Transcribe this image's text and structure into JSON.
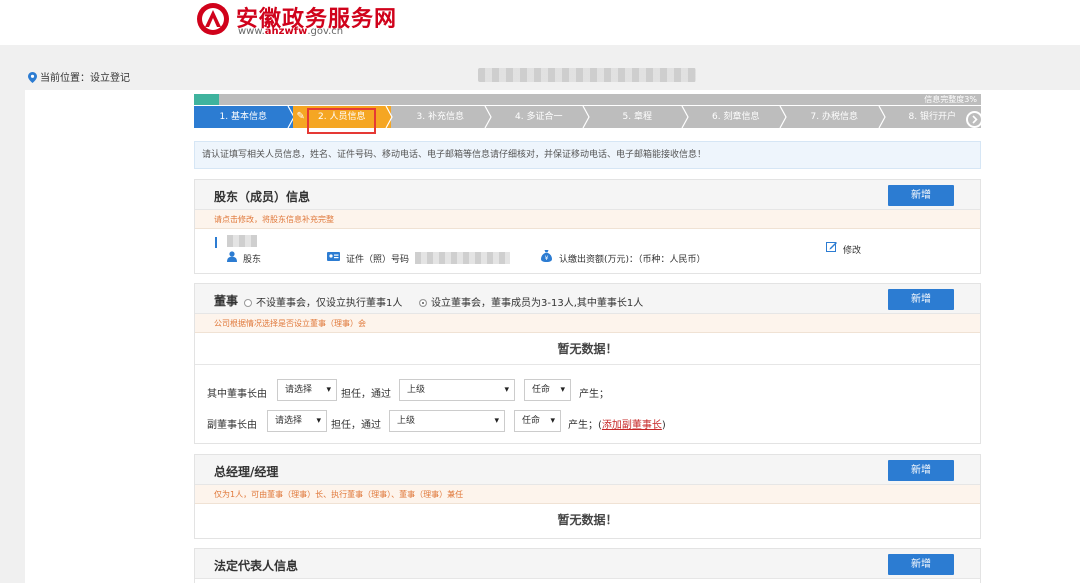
{
  "header": {
    "title": "安徽政务服务网",
    "url_prefix": "www.",
    "url_brand": "ahzwfw",
    "url_suffix": ".gov.cn"
  },
  "location": {
    "label": "当前位置：设立登记"
  },
  "progress": {
    "text": "信息完整度3%",
    "fraction": 0.03
  },
  "steps": [
    {
      "label": "1. 基本信息",
      "state": "done"
    },
    {
      "label": "2. 人员信息",
      "state": "current"
    },
    {
      "label": "3. 补充信息",
      "state": "todo"
    },
    {
      "label": "4. 多证合一",
      "state": "todo"
    },
    {
      "label": "5. 章程",
      "state": "todo"
    },
    {
      "label": "6. 刻章信息",
      "state": "todo"
    },
    {
      "label": "7. 办税信息",
      "state": "todo"
    },
    {
      "label": "8. 银行开户",
      "state": "todo"
    }
  ],
  "notice": "请认证填写相关人员信息，姓名、证件号码、移动电话、电子邮箱等信息请仔细核对，并保证移动电话、电子邮箱能接收信息！",
  "shareholder": {
    "title": "股东（成员）信息",
    "add_label": "新增",
    "tip": "请点击修改，将股东信息补充完整",
    "role": "股东",
    "id_label": "证件（照）号码",
    "capital_label": "认缴出资额(万元)：（币种：人民币）",
    "edit_label": "修改"
  },
  "board": {
    "title": "董事",
    "option_no": "不设董事会，仅设立执行董事1人",
    "option_yes": "设立董事会，董事成员为3-13人,其中董事长1人",
    "add_label": "新增",
    "tip": "公司根据情况选择是否设立董事（理事）会",
    "empty": "暂无数据！",
    "chairman_prefix": "其中董事长由",
    "vice_prefix": "副董事长由",
    "select_placeholder": "请选择",
    "serve_text": "担任，通过",
    "method_value": "上级",
    "appoint_value": "任命",
    "produce_text": "产生；",
    "produce_text_open": "产生；(",
    "add_vice_link": "添加副董事长",
    "close_paren": ")"
  },
  "manager": {
    "title": "总经理/经理",
    "add_label": "新增",
    "tip": "仅为1人，可由董事（理事）长、执行董事（理事）、董事（理事）兼任",
    "empty": "暂无数据！"
  },
  "legal_rep": {
    "title": "法定代表人信息",
    "add_label": "新增"
  },
  "colors": {
    "brand_red": "#d0021b",
    "primary_blue": "#2c7cd2",
    "current_orange": "#f5a623",
    "tip_orange": "#e0783a",
    "progress_green": "#3fb39e"
  }
}
